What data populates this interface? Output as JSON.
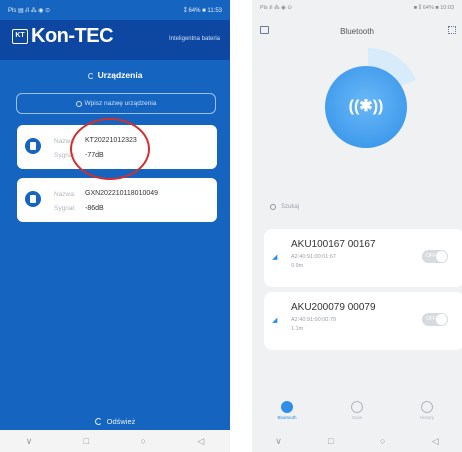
{
  "left_phone": {
    "status_left": "Pls ▤ ᵢll ⁂ ◉ ⊙",
    "status_right": "⁑ 64% ■ 11:53",
    "logo_box": "KT",
    "logo_text": "Kon-TEC",
    "logo_sub": "",
    "tagline": "Inteligentna bateria",
    "section_title": "Urządzenia",
    "search_placeholder": "Wpisz nazwę urządzenia",
    "devices": [
      {
        "name_label": "Nazwa:",
        "name": "KT20221012323",
        "signal_label": "Sygnał:",
        "signal": "-77dB"
      },
      {
        "name_label": "Nazwa:",
        "name": "GXN202210118010049",
        "signal_label": "Sygnał:",
        "signal": "-86dB"
      }
    ],
    "refresh_label": "Odśwież",
    "nav": [
      "∨",
      "□",
      "○",
      "◁"
    ]
  },
  "right_phone": {
    "status_left": "Pls ᵢll ⁂ ◉ ⊙",
    "status_right": "■ ⁑ 64% ■ 10:03",
    "title": "Bluetooth",
    "bluetooth_symbol": "((✱))",
    "search_placeholder": "Szukaj",
    "devices": [
      {
        "name": "AKU100167  00167",
        "mac": "A2:40:91:00:01:67",
        "distance": "0.9m",
        "toggle": "OFF"
      },
      {
        "name": "AKU200079  00079",
        "mac": "A2:40:91:00:00:79",
        "distance": "1.1m",
        "toggle": "OFF"
      }
    ],
    "tabs": [
      {
        "label": "Bluetooth",
        "active": true
      },
      {
        "label": "Scan",
        "active": false
      },
      {
        "label": "History",
        "active": false
      }
    ],
    "nav": [
      "∨",
      "□",
      "○",
      "◁"
    ]
  },
  "colors": {
    "brand_blue": "#1565c0",
    "bt_blue": "#2f8fe8",
    "highlight_red": "#d32f2f"
  }
}
